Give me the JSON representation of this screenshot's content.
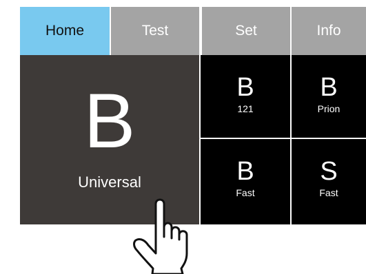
{
  "tabs": [
    {
      "label": "Home",
      "active": true
    },
    {
      "label": "Test",
      "active": false
    },
    {
      "label": "Set",
      "active": false
    },
    {
      "label": "Info",
      "active": false
    }
  ],
  "main_tile": {
    "letter": "B",
    "label": "Universal"
  },
  "tiles": [
    {
      "letter": "B",
      "caption": "121"
    },
    {
      "letter": "B",
      "caption": "Prion"
    },
    {
      "letter": "B",
      "caption": "Fast"
    },
    {
      "letter": "S",
      "caption": "Fast"
    }
  ],
  "pointer": {
    "icon": "pointing-hand-icon"
  },
  "colors": {
    "active_tab": "#79c9ef",
    "inactive_tab": "#a4a4a4",
    "main_tile": "#3e3a38",
    "tile": "#000000"
  }
}
